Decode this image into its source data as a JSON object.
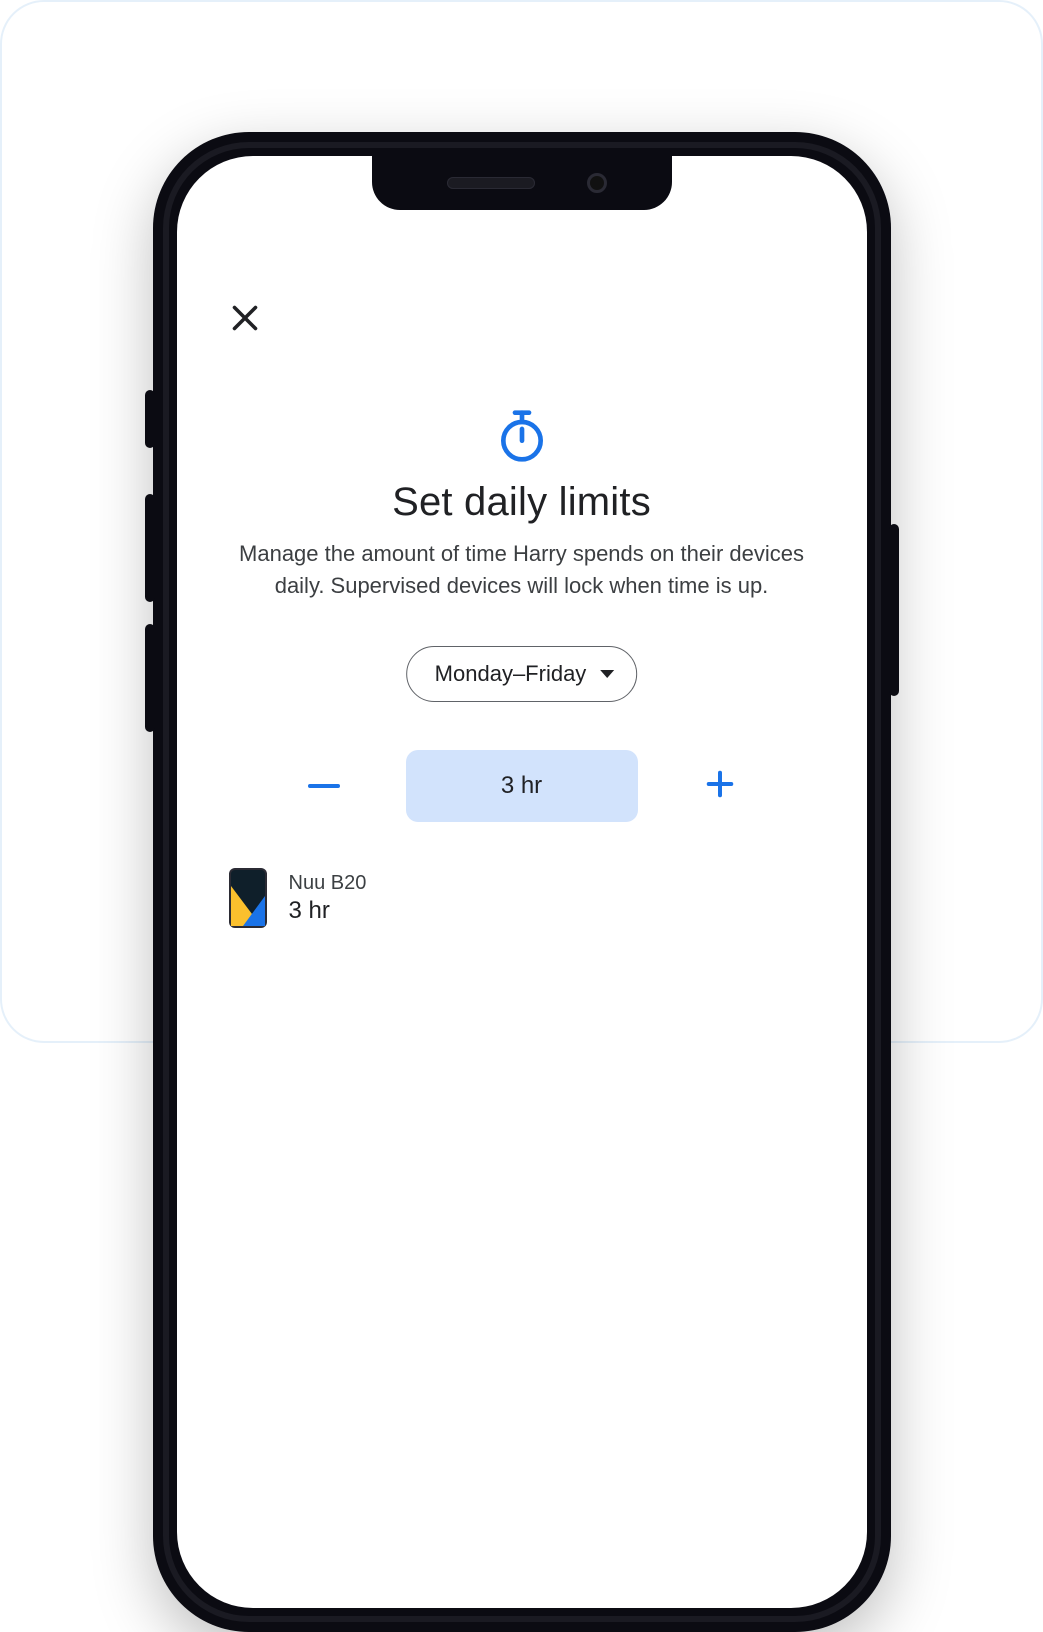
{
  "colors": {
    "accent": "#1a73e8",
    "chip_bg": "#d2e3fc",
    "text": "#202124"
  },
  "header": {
    "close_label": "Close"
  },
  "page": {
    "icon": "timer-icon",
    "title": "Set daily limits",
    "subtitle": "Manage the amount of time Harry spends on their devices daily. Supervised devices will lock when time is up."
  },
  "day_selector": {
    "selected_label": "Monday–Friday"
  },
  "limit_stepper": {
    "decrease_label": "Decrease time",
    "increase_label": "Increase time",
    "value_display": "3 hr"
  },
  "devices": [
    {
      "name": "Nuu B20",
      "limit_display": "3 hr"
    }
  ]
}
